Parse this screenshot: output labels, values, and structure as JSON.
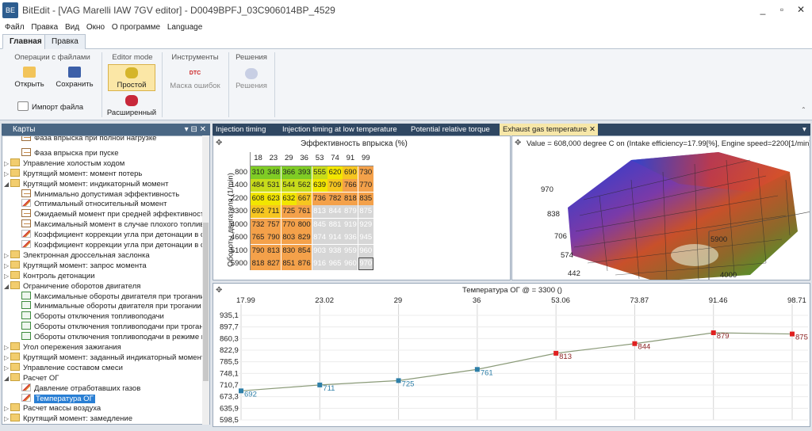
{
  "titlebar": {
    "icon_text": "BE",
    "title": "BitEdit - [VAG Marelli IAW 7GV editor] - D0049BPFJ_03C906014BP_4529",
    "minimize": "_",
    "restore": "▫",
    "close": "✕"
  },
  "menu": [
    "Файл",
    "Правка",
    "Вид",
    "Окно",
    "О программе",
    "Language"
  ],
  "ribbon_tabs": [
    "Главная",
    "Правка"
  ],
  "ribbon": {
    "file_ops": {
      "title": "Операции с файлами",
      "open": "Открыть",
      "save": "Сохранить",
      "import": "Импорт файла"
    },
    "editor_mode": {
      "title": "Editor mode",
      "simple": "Простой",
      "advanced": "Расширенный"
    },
    "tools": {
      "title": "Инструменты",
      "dtc_badge": "DTC",
      "error_mask": "Маска ошибок"
    },
    "solutions": {
      "title": "Решения",
      "label": "Решения"
    }
  },
  "left_panel": {
    "title": "Карты",
    "controls": "▾ ⊟ ✕"
  },
  "tree": [
    {
      "label": "Фаза впрыска при полной нагрузке",
      "level": 1,
      "icon": "table",
      "cut": true
    },
    {
      "label": "Фаза впрыска при пуске",
      "level": 1,
      "icon": "table"
    },
    {
      "label": "Управление холостым ходом",
      "level": 0,
      "icon": "folder",
      "exp": "+"
    },
    {
      "label": "Крутящий момент: момент потерь",
      "level": 0,
      "icon": "folder",
      "exp": "+"
    },
    {
      "label": "Крутящий момент: индикаторный момент",
      "level": 0,
      "icon": "folder",
      "exp": "-"
    },
    {
      "label": "Минимально допустимая эффективность",
      "level": 1,
      "icon": "table"
    },
    {
      "label": "Оптимальный относительный момент",
      "level": 1,
      "icon": "graph"
    },
    {
      "label": "Ожидаемый момент при средней эффективности",
      "level": 1,
      "icon": "table"
    },
    {
      "label": "Максимальный момент в случае плохого топлива",
      "level": 1,
      "icon": "table"
    },
    {
      "label": "Коэффициент коррекции угла при детонации в слу",
      "level": 1,
      "icon": "graph"
    },
    {
      "label": "Коэффициент коррекции угла при детонации в слу",
      "level": 1,
      "icon": "graph"
    },
    {
      "label": "Электронная дроссельная заслонка",
      "level": 0,
      "icon": "folder",
      "exp": "+"
    },
    {
      "label": "Крутящий момент: запрос момента",
      "level": 0,
      "icon": "folder",
      "exp": "+"
    },
    {
      "label": "Контроль детонации",
      "level": 0,
      "icon": "folder",
      "exp": "+"
    },
    {
      "label": "Ограничение оборотов двигателя",
      "level": 0,
      "icon": "folder",
      "exp": "-"
    },
    {
      "label": "Максимальные обороты двигателя при трогании",
      "level": 1,
      "icon": "const"
    },
    {
      "label": "Минимальные обороты двигателя при трогании",
      "level": 1,
      "icon": "const"
    },
    {
      "label": "Обороты отключения топливоподачи",
      "level": 1,
      "icon": "const"
    },
    {
      "label": "Обороты отключения топливоподачи при трогани",
      "level": 1,
      "icon": "const"
    },
    {
      "label": "Обороты отключения топливоподачи в режиме вс",
      "level": 1,
      "icon": "const"
    },
    {
      "label": "Угол опережения зажигания",
      "level": 0,
      "icon": "folder",
      "exp": "+"
    },
    {
      "label": "Крутящий момент: заданный индикаторный момент",
      "level": 0,
      "icon": "folder",
      "exp": "+"
    },
    {
      "label": "Управление составом смеси",
      "level": 0,
      "icon": "folder",
      "exp": "+"
    },
    {
      "label": "Расчет ОГ",
      "level": 0,
      "icon": "folder",
      "exp": "-"
    },
    {
      "label": "Давление отработавших газов",
      "level": 1,
      "icon": "graph"
    },
    {
      "label": "Температура ОГ",
      "level": 1,
      "icon": "graph",
      "selected": true
    },
    {
      "label": "Расчет массы воздуха",
      "level": 0,
      "icon": "folder",
      "exp": "+"
    },
    {
      "label": "Крутящий момент: замедление",
      "level": 0,
      "icon": "folder",
      "exp": "+"
    }
  ],
  "doc_tabs": [
    "Injection timing",
    "Injection timing at low temperature",
    "Potential relative torque",
    "Exhaust gas temperature"
  ],
  "map": {
    "title": "Эффективность впрыска (%)",
    "ylabel": "Обороты двигателя (1/min)",
    "cols": [
      "18",
      "23",
      "29",
      "36",
      "53",
      "74",
      "91",
      "99"
    ],
    "rows": [
      "800",
      "1400",
      "2200",
      "3300",
      "4000",
      "4600",
      "5100",
      "5900"
    ],
    "values": [
      [
        "310",
        "348",
        "366",
        "393",
        "555",
        "620",
        "690",
        "730"
      ],
      [
        "484",
        "531",
        "544",
        "562",
        "639",
        "709",
        "766",
        "770"
      ],
      [
        "608",
        "623",
        "632",
        "667",
        "736",
        "782",
        "818",
        "835"
      ],
      [
        "692",
        "711",
        "725",
        "761",
        "813",
        "844",
        "879",
        "875"
      ],
      [
        "732",
        "757",
        "770",
        "800",
        "845",
        "881",
        "919",
        "929"
      ],
      [
        "765",
        "790",
        "803",
        "829",
        "874",
        "914",
        "936",
        "945"
      ],
      [
        "790",
        "813",
        "830",
        "854",
        "903",
        "938",
        "959",
        "960"
      ],
      [
        "818",
        "827",
        "851",
        "876",
        "916",
        "965",
        "960",
        "970"
      ]
    ],
    "colors": {
      "green": "#7fcc25",
      "yellow": "#f2e600",
      "orange": "#f4a14a",
      "gray": "#d6d6d6",
      "gray_text": "#ffffff"
    }
  },
  "surface": {
    "info": "Value = 608,000 degree C on (Intake efficiency=17.99[%], Engine speed=2200[1/min]), an",
    "z_ticks": [
      "970",
      "838",
      "706",
      "574",
      "442"
    ],
    "rpm_ticks": [
      "5900",
      "4000"
    ]
  },
  "line_chart": {
    "title": "Температура ОГ @  = 3300 ()"
  },
  "chart_data": {
    "type": "line",
    "title": "Температура ОГ @  = 3300 ()",
    "x": [
      17.99,
      23.02,
      29,
      36,
      53.06,
      73.87,
      91.46,
      98.71
    ],
    "x_tick_labels": [
      "17.99",
      "23.02",
      "29",
      "36",
      "53.06",
      "73.87",
      "91.46",
      "98.71"
    ],
    "y": [
      692,
      711,
      725,
      761,
      813,
      844,
      879,
      875
    ],
    "point_labels": [
      "692",
      "711",
      "725",
      "761",
      "813",
      "844",
      "879",
      "875"
    ],
    "point_colors": [
      "#2e7fa8",
      "#2e7fa8",
      "#2e7fa8",
      "#2e7fa8",
      "#e02020",
      "#e02020",
      "#e02020",
      "#e02020"
    ],
    "y_tick_labels": [
      "935,1",
      "897,7",
      "860,3",
      "822,9",
      "785,5",
      "748,1",
      "710,7",
      "673,3",
      "635,9",
      "598,5"
    ],
    "ylim": [
      598.5,
      935.1
    ],
    "grid": true,
    "line_color": "#8a9a78"
  }
}
